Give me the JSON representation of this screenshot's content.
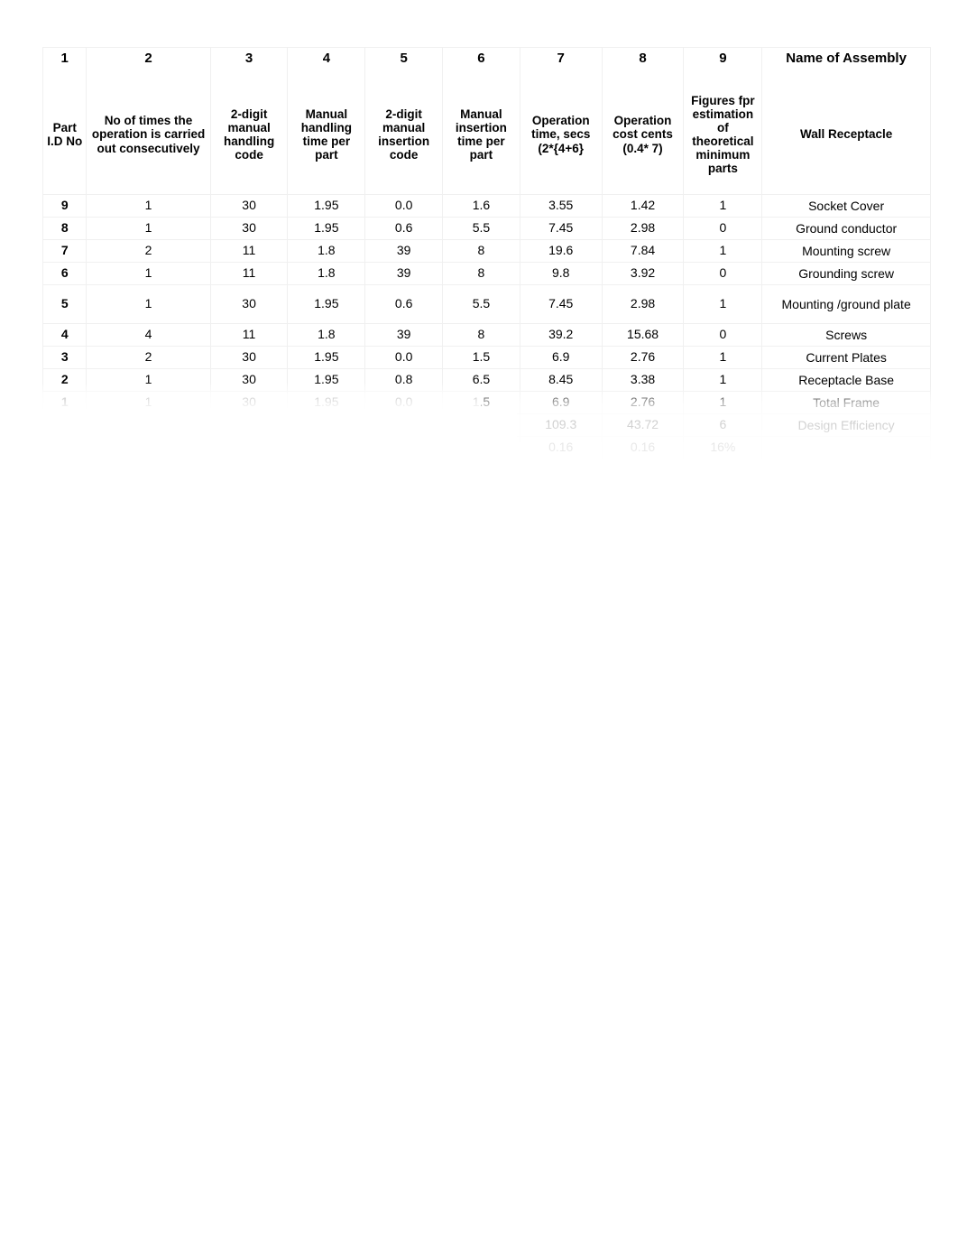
{
  "table": {
    "column_numbers": [
      "1",
      "2",
      "3",
      "4",
      "5",
      "6",
      "7",
      "8",
      "9"
    ],
    "assembly_label": "Name of Assembly",
    "assembly_name": "Wall Receptacle",
    "headers": [
      "Part I.D No",
      "No of times the operation is carried out consecutively",
      "2-digit manual handling code",
      "Manual handling time per part",
      "2-digit manual insertion code",
      "Manual insertion time per part",
      "Operation time, secs (2*{4+6}",
      "Operation cost cents (0.4* 7)",
      "Figures fpr estimation of theoretical minimum parts"
    ],
    "rows": [
      {
        "id": "9",
        "times": "1",
        "handling_code": "30",
        "handling_time": "1.95",
        "insertion_code": "0.0",
        "insertion_time": "1.6",
        "operation_time": "3.55",
        "operation_cost": "1.42",
        "min_parts": "1",
        "name": "Socket Cover"
      },
      {
        "id": "8",
        "times": "1",
        "handling_code": "30",
        "handling_time": "1.95",
        "insertion_code": "0.6",
        "insertion_time": "5.5",
        "operation_time": "7.45",
        "operation_cost": "2.98",
        "min_parts": "0",
        "name": "Ground conductor"
      },
      {
        "id": "7",
        "times": "2",
        "handling_code": "11",
        "handling_time": "1.8",
        "insertion_code": "39",
        "insertion_time": "8",
        "operation_time": "19.6",
        "operation_cost": "7.84",
        "min_parts": "1",
        "name": "Mounting screw"
      },
      {
        "id": "6",
        "times": "1",
        "handling_code": "11",
        "handling_time": "1.8",
        "insertion_code": "39",
        "insertion_time": "8",
        "operation_time": "9.8",
        "operation_cost": "3.92",
        "min_parts": "0",
        "name": "Grounding screw"
      },
      {
        "id": "5",
        "times": "1",
        "handling_code": "30",
        "handling_time": "1.95",
        "insertion_code": "0.6",
        "insertion_time": "5.5",
        "operation_time": "7.45",
        "operation_cost": "2.98",
        "min_parts": "1",
        "name": "Mounting /ground plate"
      },
      {
        "id": "4",
        "times": "4",
        "handling_code": "11",
        "handling_time": "1.8",
        "insertion_code": "39",
        "insertion_time": "8",
        "operation_time": "39.2",
        "operation_cost": "15.68",
        "min_parts": "0",
        "name": "Screws"
      },
      {
        "id": "3",
        "times": "2",
        "handling_code": "30",
        "handling_time": "1.95",
        "insertion_code": "0.0",
        "insertion_time": "1.5",
        "operation_time": "6.9",
        "operation_cost": "2.76",
        "min_parts": "1",
        "name": "Current Plates"
      },
      {
        "id": "2",
        "times": "1",
        "handling_code": "30",
        "handling_time": "1.95",
        "insertion_code": "0.8",
        "insertion_time": "6.5",
        "operation_time": "8.45",
        "operation_cost": "3.38",
        "min_parts": "1",
        "name": "Receptacle Base"
      },
      {
        "id": "1",
        "times": "1",
        "handling_code": "30",
        "handling_time": "1.95",
        "insertion_code": "0.0",
        "insertion_time": "1.5",
        "operation_time": "6.9",
        "operation_cost": "2.76",
        "min_parts": "1",
        "name": "Total Frame"
      },
      {
        "id": "",
        "times": "",
        "handling_code": "",
        "handling_time": "",
        "insertion_code": "",
        "insertion_time": "",
        "operation_time": "109.3",
        "operation_cost": "43.72",
        "min_parts": "6",
        "name": "Design Efficiency"
      },
      {
        "id": "",
        "times": "",
        "handling_code": "",
        "handling_time": "",
        "insertion_code": "",
        "insertion_time": "",
        "operation_time": "0.16",
        "operation_cost": "0.16",
        "min_parts": "16%",
        "name": ""
      }
    ]
  }
}
